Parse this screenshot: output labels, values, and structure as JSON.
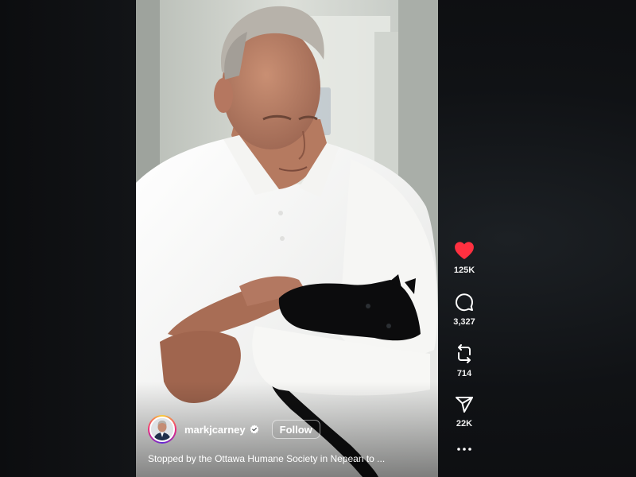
{
  "post": {
    "author": {
      "username": "markjcarney",
      "verified": true,
      "avatar_icon": "profile-photo"
    },
    "follow_label": "Follow",
    "caption": "Stopped by the Ottawa Humane Society in Nepean to ...",
    "media_description": "photo"
  },
  "actions": {
    "like": {
      "icon": "heart-icon-filled",
      "count": "125K",
      "color": "#ff3040"
    },
    "comment": {
      "icon": "comment-icon",
      "count": "3,327"
    },
    "repost": {
      "icon": "repost-icon",
      "count": "714"
    },
    "share": {
      "icon": "send-icon",
      "count": "22K"
    },
    "more": {
      "icon": "more-icon"
    }
  },
  "colors": {
    "background": "#0d0f12",
    "text": "#ffffff",
    "like": "#ff3040"
  }
}
